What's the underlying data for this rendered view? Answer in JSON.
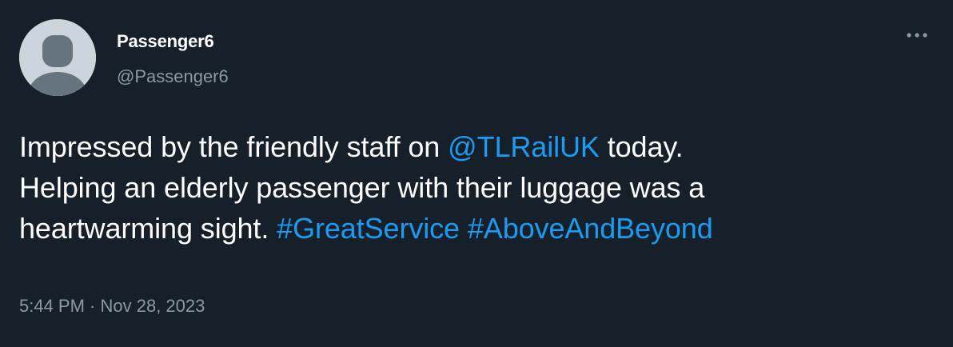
{
  "tweet": {
    "display_name": "Passenger6",
    "handle": "@Passenger6",
    "more_icon": "more-horizontal-icon",
    "avatar_icon": "default-avatar-icon",
    "body": {
      "line1": {
        "text_before": "Impressed by the friendly staff on ",
        "mention": "@TLRailUK",
        "text_after": " today."
      },
      "line2": {
        "text": "Helping an elderly passenger with their luggage was a"
      },
      "line3": {
        "text_before": "heartwarming sight. ",
        "hashtag1": "#GreatService",
        "space": " ",
        "hashtag2": "#AboveAndBeyond"
      }
    },
    "time": "5:44 PM",
    "separator": " · ",
    "date": "Nov 28, 2023"
  },
  "colors": {
    "background": "#15202b",
    "text": "#ffffff",
    "secondary_text": "#8b98a5",
    "link": "#1d9bf0",
    "avatar_bg": "#cdd5dc",
    "avatar_silhouette": "#66747f"
  }
}
